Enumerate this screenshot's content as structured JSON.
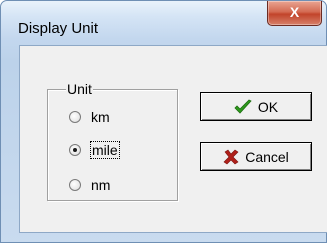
{
  "window": {
    "title": "Display Unit",
    "close_glyph": "X"
  },
  "unit_group": {
    "label": "Unit",
    "options": [
      {
        "label": "km",
        "selected": false
      },
      {
        "label": "mile",
        "selected": true
      },
      {
        "label": "nm",
        "selected": false
      }
    ]
  },
  "buttons": {
    "ok": {
      "label": "OK",
      "icon": "checkmark-icon",
      "color": "#2e9a1d"
    },
    "cancel": {
      "label": "Cancel",
      "icon": "x-mark-icon",
      "color": "#b0201a"
    }
  }
}
